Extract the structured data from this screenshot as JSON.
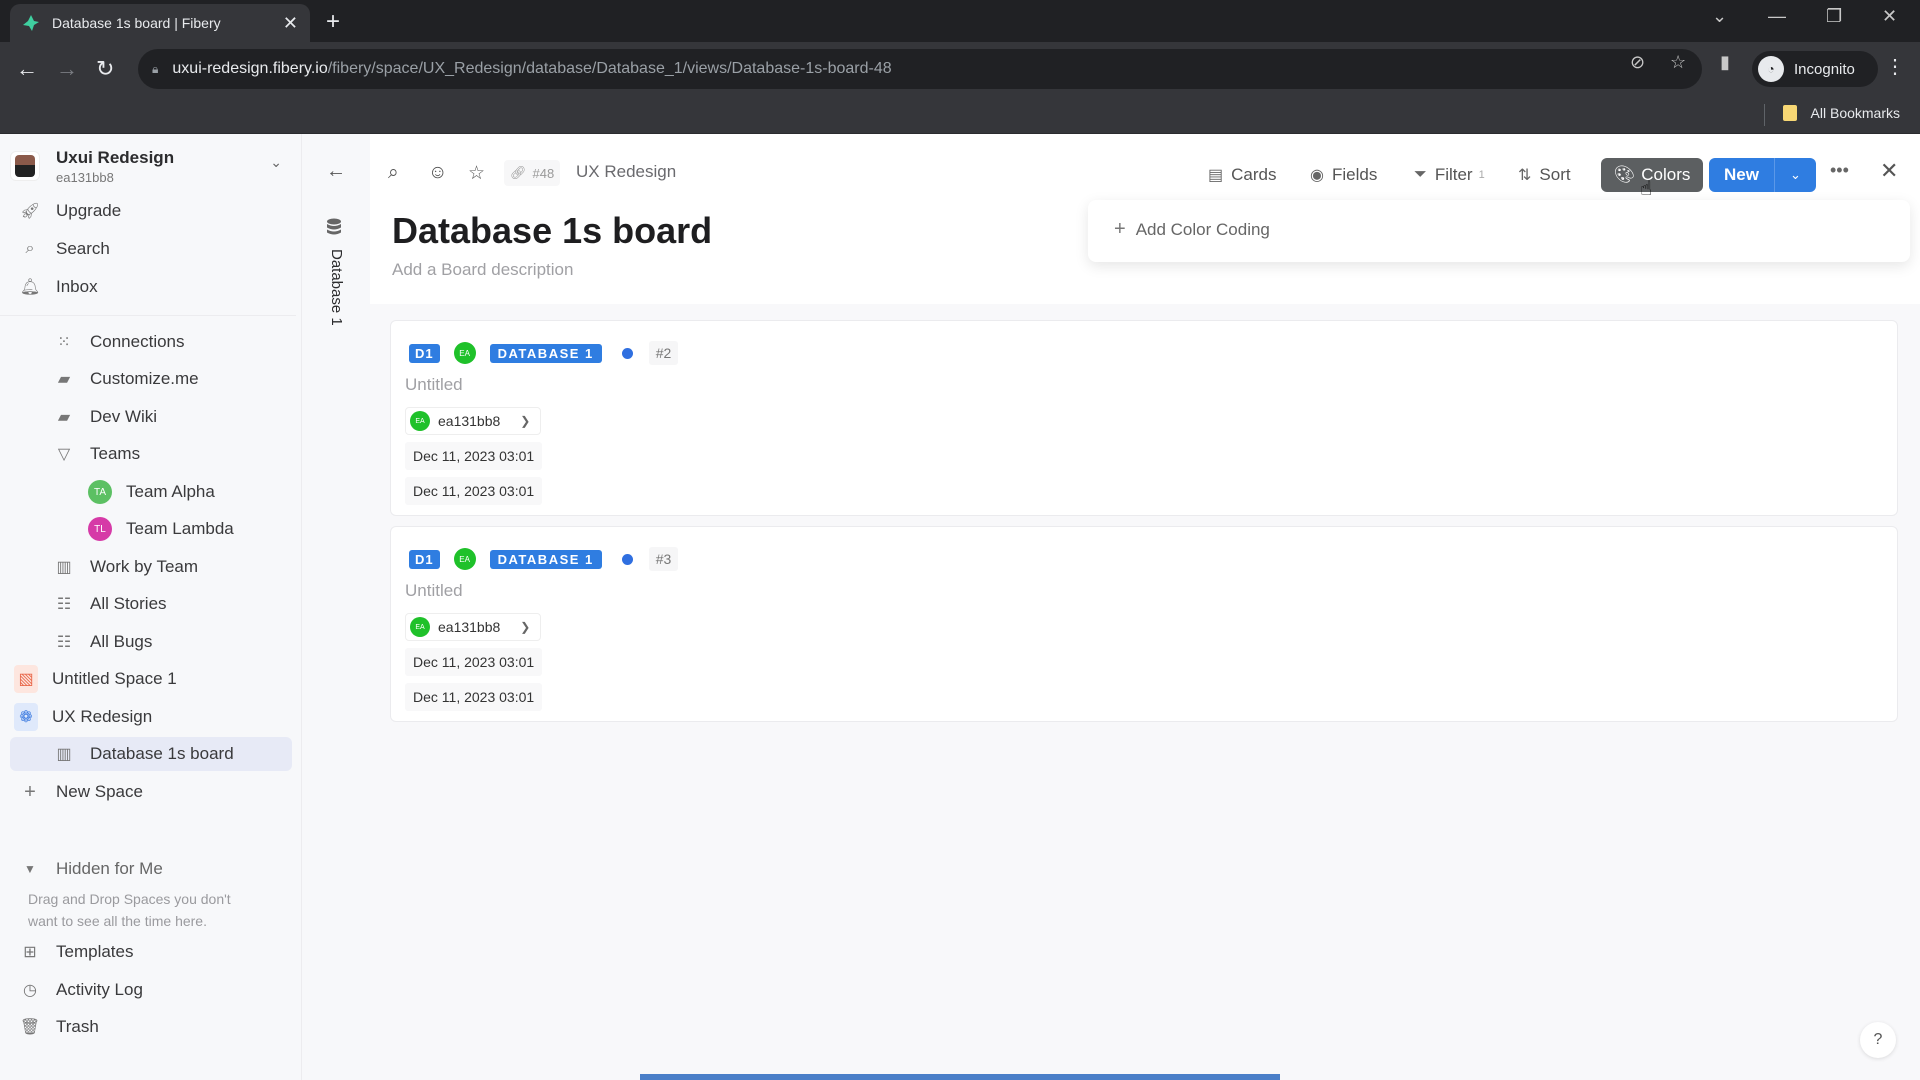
{
  "browser": {
    "tab_title": "Database 1s board | Fibery",
    "url_host": "uxui-redesign.fibery.io",
    "url_path": "/fibery/space/UX_Redesign/database/Database_1/views/Database-1s-board-48",
    "profile_label": "Incognito",
    "bookmarks_label": "All Bookmarks"
  },
  "workspace": {
    "name": "Uxui Redesign",
    "user": "ea131bb8"
  },
  "sidebar": {
    "top_items": [
      {
        "label": "Upgrade",
        "icon": "rocket-icon"
      },
      {
        "label": "Search",
        "icon": "search-icon"
      },
      {
        "label": "Inbox",
        "icon": "bell-icon"
      }
    ],
    "tree": [
      {
        "label": "Connections",
        "icon": "connections-icon"
      },
      {
        "label": "Customize.me",
        "icon": "document-icon"
      },
      {
        "label": "Dev Wiki",
        "icon": "document-icon"
      },
      {
        "label": "Teams",
        "icon": "triangle-down-icon"
      },
      {
        "label": "Team Alpha",
        "initials": "TA",
        "color": "#5cc063"
      },
      {
        "label": "Team Lambda",
        "initials": "TL",
        "color": "#d63aa7"
      },
      {
        "label": "Work by Team",
        "icon": "board-icon"
      },
      {
        "label": "All Stories",
        "icon": "grid-icon"
      },
      {
        "label": "All Bugs",
        "icon": "grid-icon"
      }
    ],
    "spaces": [
      {
        "label": "Untitled Space 1",
        "icon": "space-icon",
        "color": "#e9694c"
      },
      {
        "label": "UX Redesign",
        "icon": "brain-icon",
        "color": "#3d7be0"
      }
    ],
    "active_item": "Database 1s board",
    "new_space": "New Space",
    "hidden_section": "Hidden for Me",
    "hidden_hint": "Drag and Drop Spaces you don't want to see all the time here.",
    "bottom_items": [
      {
        "label": "Templates",
        "icon": "templates-icon"
      },
      {
        "label": "Activity Log",
        "icon": "clock-icon"
      },
      {
        "label": "Trash",
        "icon": "trash-icon"
      }
    ]
  },
  "rail": {
    "database_label": "Database 1"
  },
  "header": {
    "id_label": "#48",
    "breadcrumb": "UX Redesign",
    "title": "Database 1s board",
    "description_placeholder": "Add a Board description",
    "buttons": {
      "cards": "Cards",
      "fields": "Fields",
      "filter": "Filter",
      "filter_count": "1",
      "sort": "Sort",
      "colors": "Colors",
      "new": "New"
    }
  },
  "colors_popover": {
    "add_label": "Add Color Coding"
  },
  "cards": [
    {
      "db_short": "D1",
      "owner_initials": "EA",
      "db_label": "DATABASE 1",
      "number": "#2",
      "title": "Untitled",
      "user": "ea131bb8",
      "date1": "Dec 11, 2023 03:01",
      "date2": "Dec 11, 2023 03:01"
    },
    {
      "db_short": "D1",
      "owner_initials": "EA",
      "db_label": "DATABASE 1",
      "number": "#3",
      "title": "Untitled",
      "user": "ea131bb8",
      "date1": "Dec 11, 2023 03:01",
      "date2": "Dec 11, 2023 03:01"
    }
  ],
  "help_label": "?",
  "colors": {
    "accent": "#2f7de1",
    "colors_button": "#5c5f61",
    "owner_avatar": "#1fc12a"
  }
}
